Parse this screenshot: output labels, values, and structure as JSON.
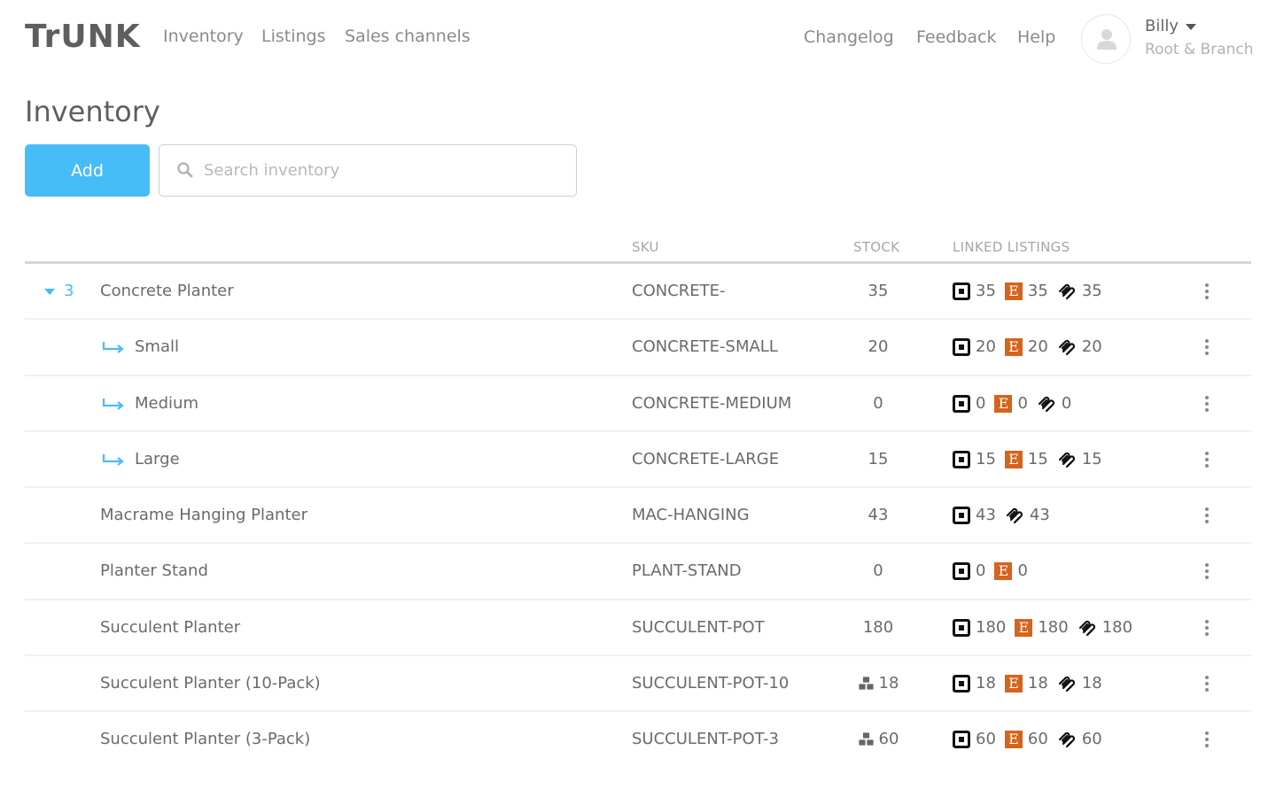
{
  "header": {
    "logo": "TrUNK",
    "nav": [
      {
        "label": "Inventory"
      },
      {
        "label": "Listings"
      },
      {
        "label": "Sales channels"
      }
    ],
    "right_links": [
      {
        "label": "Changelog"
      },
      {
        "label": "Feedback"
      },
      {
        "label": "Help"
      }
    ],
    "user": {
      "name": "Billy",
      "org": "Root & Branch",
      "avatar_icon": "user-silhouette-icon"
    }
  },
  "page": {
    "title": "Inventory",
    "add_label": "Add",
    "search": {
      "placeholder": "Search inventory",
      "value": "",
      "icon": "search-icon"
    }
  },
  "colors": {
    "accent": "#47bdf8",
    "etsy": "#d5641c",
    "square": "#111111"
  },
  "table": {
    "columns": [
      "",
      "SKU",
      "STOCK",
      "LINKED LISTINGS"
    ],
    "rows": [
      {
        "name": "Concrete Planter",
        "sku": "CONCRETE-",
        "stock": "35",
        "type": "parent",
        "variant_count": "3",
        "bundle": false,
        "listings": [
          {
            "channel": "square",
            "qty": "35"
          },
          {
            "channel": "etsy",
            "qty": "35"
          },
          {
            "channel": "squarespace",
            "qty": "35"
          }
        ]
      },
      {
        "name": "Small",
        "sku": "CONCRETE-SMALL",
        "stock": "20",
        "type": "child",
        "bundle": false,
        "listings": [
          {
            "channel": "square",
            "qty": "20"
          },
          {
            "channel": "etsy",
            "qty": "20"
          },
          {
            "channel": "squarespace",
            "qty": "20"
          }
        ]
      },
      {
        "name": "Medium",
        "sku": "CONCRETE-MEDIUM",
        "stock": "0",
        "type": "child",
        "bundle": false,
        "listings": [
          {
            "channel": "square",
            "qty": "0"
          },
          {
            "channel": "etsy",
            "qty": "0"
          },
          {
            "channel": "squarespace",
            "qty": "0"
          }
        ]
      },
      {
        "name": "Large",
        "sku": "CONCRETE-LARGE",
        "stock": "15",
        "type": "child",
        "bundle": false,
        "listings": [
          {
            "channel": "square",
            "qty": "15"
          },
          {
            "channel": "etsy",
            "qty": "15"
          },
          {
            "channel": "squarespace",
            "qty": "15"
          }
        ]
      },
      {
        "name": "Macrame Hanging Planter",
        "sku": "MAC-HANGING",
        "stock": "43",
        "type": "item",
        "bundle": false,
        "listings": [
          {
            "channel": "square",
            "qty": "43"
          },
          {
            "channel": "squarespace",
            "qty": "43"
          }
        ]
      },
      {
        "name": "Planter Stand",
        "sku": "PLANT-STAND",
        "stock": "0",
        "type": "item",
        "bundle": false,
        "listings": [
          {
            "channel": "square",
            "qty": "0"
          },
          {
            "channel": "etsy",
            "qty": "0"
          }
        ]
      },
      {
        "name": "Succulent Planter",
        "sku": "SUCCULENT-POT",
        "stock": "180",
        "type": "item",
        "bundle": false,
        "listings": [
          {
            "channel": "square",
            "qty": "180"
          },
          {
            "channel": "etsy",
            "qty": "180"
          },
          {
            "channel": "squarespace",
            "qty": "180"
          }
        ]
      },
      {
        "name": "Succulent Planter (10-Pack)",
        "sku": "SUCCULENT-POT-10",
        "stock": "18",
        "type": "item",
        "bundle": true,
        "listings": [
          {
            "channel": "square",
            "qty": "18"
          },
          {
            "channel": "etsy",
            "qty": "18"
          },
          {
            "channel": "squarespace",
            "qty": "18"
          }
        ]
      },
      {
        "name": "Succulent Planter (3-Pack)",
        "sku": "SUCCULENT-POT-3",
        "stock": "60",
        "type": "item",
        "bundle": true,
        "listings": [
          {
            "channel": "square",
            "qty": "60"
          },
          {
            "channel": "etsy",
            "qty": "60"
          },
          {
            "channel": "squarespace",
            "qty": "60"
          }
        ]
      }
    ]
  }
}
